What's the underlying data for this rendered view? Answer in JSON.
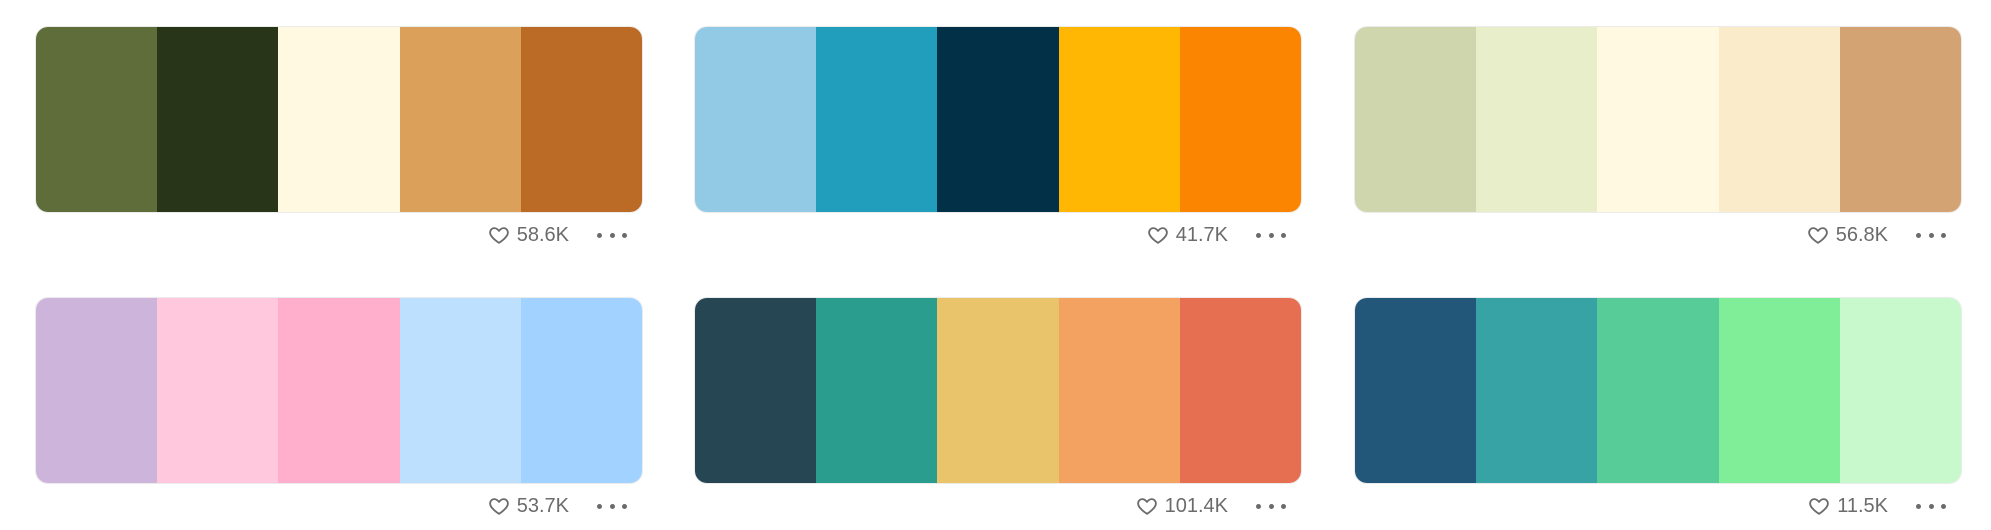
{
  "palettes": [
    {
      "colors": [
        "#5E6D39",
        "#293519",
        "#FEF9E0",
        "#DBA05A",
        "#BC6B26"
      ],
      "likes": "58.6K"
    },
    {
      "colors": [
        "#92CAE6",
        "#219EBC",
        "#023047",
        "#FFB703",
        "#FB8500"
      ],
      "likes": "41.7K"
    },
    {
      "colors": [
        "#CFD6AE",
        "#E8EDCA",
        "#FEF9E0",
        "#FAECCB",
        "#D3A374"
      ],
      "likes": "56.8K"
    },
    {
      "colors": [
        "#CDB4DB",
        "#FFC8DD",
        "#FFAFCC",
        "#BDE0FE",
        "#A2D2FF"
      ],
      "likes": "53.7K"
    },
    {
      "colors": [
        "#264653",
        "#2A9D8F",
        "#E9C46A",
        "#F4A261",
        "#E76F51"
      ],
      "likes": "101.4K"
    },
    {
      "colors": [
        "#22577A",
        "#38A3A5",
        "#57CC99",
        "#80ED99",
        "#C7F9CC"
      ],
      "likes": "11.5K"
    }
  ]
}
